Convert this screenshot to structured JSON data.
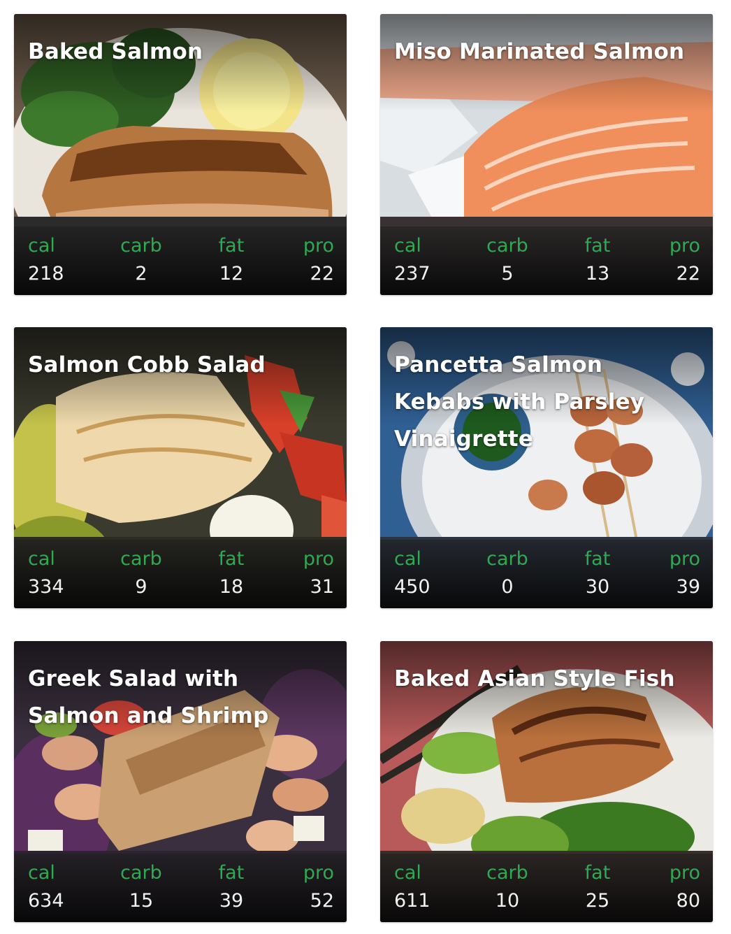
{
  "recipes": [
    {
      "title": "Baked Salmon",
      "image": "baked-salmon-photo",
      "cal": "218",
      "carb": "2",
      "fat": "12",
      "pro": "22"
    },
    {
      "title": "Miso Marinated Salmon",
      "image": "raw-salmon-photo",
      "cal": "237",
      "carb": "5",
      "fat": "13",
      "pro": "22"
    },
    {
      "title": "Salmon Cobb Salad",
      "image": "cobb-salad-photo",
      "cal": "334",
      "carb": "9",
      "fat": "18",
      "pro": "31"
    },
    {
      "title": "Pancetta Salmon Kebabs with Parsley Vinaigrette",
      "image": "kebabs-photo",
      "cal": "450",
      "carb": "0",
      "fat": "30",
      "pro": "39"
    },
    {
      "title": "Greek Salad with Salmon and Shrimp",
      "image": "greek-salad-photo",
      "cal": "634",
      "carb": "15",
      "fat": "39",
      "pro": "52"
    },
    {
      "title": "Baked Asian Style Fish",
      "image": "asian-fish-photo",
      "cal": "611",
      "carb": "10",
      "fat": "25",
      "pro": "80"
    }
  ],
  "labels": {
    "cal": "cal",
    "carb": "carb",
    "fat": "fat",
    "pro": "pro"
  },
  "colors": {
    "label_green": "#2faa52",
    "value_white": "#f2f2f2",
    "title_white": "#ffffff"
  }
}
